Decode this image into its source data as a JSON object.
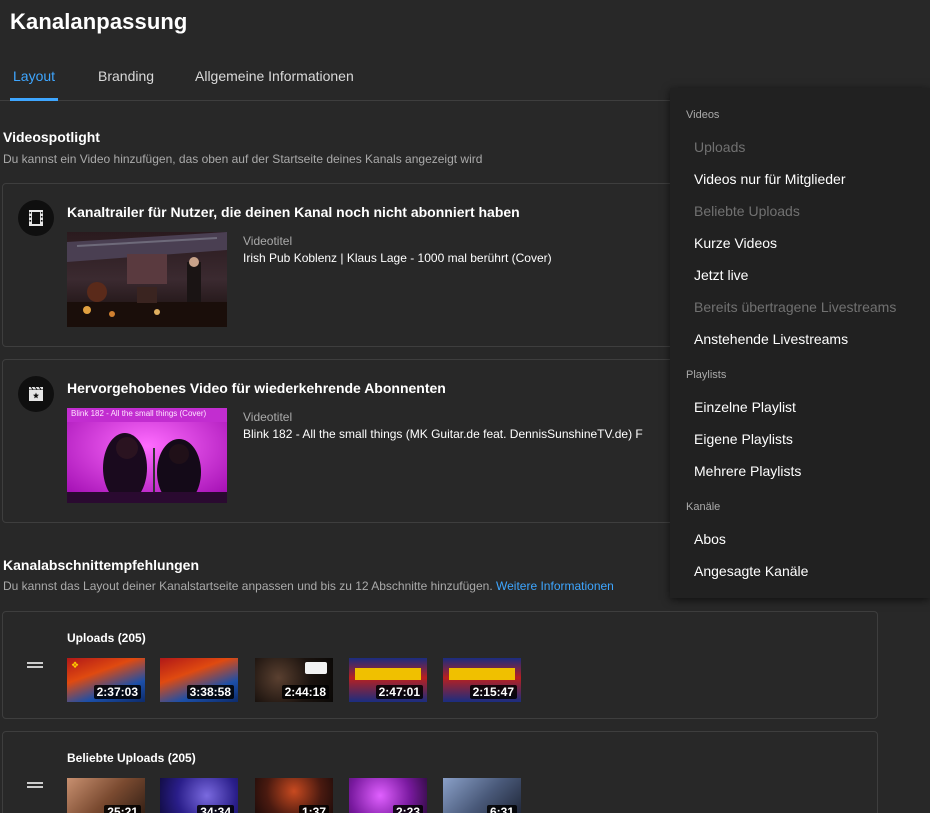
{
  "page": {
    "title": "Kanalanpassung"
  },
  "tabs": [
    {
      "label": "Layout",
      "active": true
    },
    {
      "label": "Branding",
      "active": false
    },
    {
      "label": "Allgemeine Informationen",
      "active": false
    }
  ],
  "spotlight": {
    "title": "Videospotlight",
    "description": "Du kannst ein Video hinzufügen, das oben auf der Startseite deines Kanals angezeigt wird",
    "trailer": {
      "icon": "film-icon",
      "heading": "Kanaltrailer für Nutzer, die deinen Kanal noch nicht abonniert haben",
      "meta_label": "Videotitel",
      "video_title": "Irish Pub Koblenz | Klaus Lage - 1000 mal berührt (Cover)"
    },
    "featured": {
      "icon": "featured-video-icon",
      "heading": "Hervorgehobenes Video für wiederkehrende Abonnenten",
      "meta_label": "Videotitel",
      "video_title": "Blink 182 - All the small things (MK Guitar.de feat. DennisSunshineTV.de) F",
      "thumb_caption": "Blink 182 - All the small things (Cover)"
    }
  },
  "sections": {
    "title": "Kanalabschnittempfehlungen",
    "description": "Du kannst das Layout deiner Kanalstartseite anpassen und bis zu 12 Abschnitte hinzufügen.",
    "link": "Weitere Informationen",
    "shelves": [
      {
        "name": "Uploads",
        "count": "(205)",
        "durations": [
          "2:37:03",
          "3:38:58",
          "2:44:18",
          "2:47:01",
          "2:15:47"
        ]
      },
      {
        "name": "Beliebte Uploads",
        "count": "(205)",
        "durations": [
          "25:21",
          "34:34",
          "1:37",
          "2:23",
          "6:31"
        ]
      }
    ]
  },
  "menu": {
    "groups": [
      {
        "header": "Videos",
        "items": [
          {
            "label": "Uploads",
            "disabled": true
          },
          {
            "label": "Videos nur für Mitglieder",
            "disabled": false
          },
          {
            "label": "Beliebte Uploads",
            "disabled": true
          },
          {
            "label": "Kurze Videos",
            "disabled": false
          },
          {
            "label": "Jetzt live",
            "disabled": false
          },
          {
            "label": "Bereits übertragene Livestreams",
            "disabled": true
          },
          {
            "label": "Anstehende Livestreams",
            "disabled": false
          }
        ]
      },
      {
        "header": "Playlists",
        "items": [
          {
            "label": "Einzelne Playlist",
            "disabled": false
          },
          {
            "label": "Eigene Playlists",
            "disabled": false
          },
          {
            "label": "Mehrere Playlists",
            "disabled": false
          }
        ]
      },
      {
        "header": "Kanäle",
        "items": [
          {
            "label": "Abos",
            "disabled": false
          },
          {
            "label": "Angesagte Kanäle",
            "disabled": false
          }
        ]
      }
    ]
  },
  "colors": {
    "background": "#282828",
    "accent": "#3ea6ff",
    "menu_bg": "#212121",
    "disabled_text": "#717171"
  }
}
